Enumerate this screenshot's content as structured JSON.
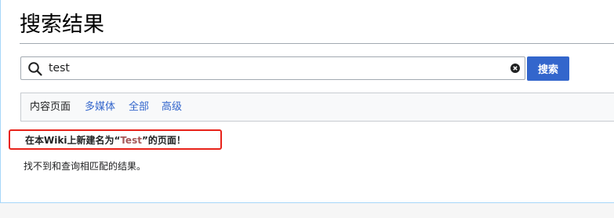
{
  "page": {
    "title": "搜索结果"
  },
  "search": {
    "value": "test",
    "button_label": "搜索"
  },
  "filters": [
    {
      "label": "内容页面",
      "current": true
    },
    {
      "label": "多媒体",
      "current": false
    },
    {
      "label": "全部",
      "current": false
    },
    {
      "label": "高级",
      "current": false
    }
  ],
  "create_notice": {
    "prefix": "在本Wiki上新建名为“",
    "link": "Test",
    "suffix": "”的页面！"
  },
  "results": {
    "message": "找不到和查询相匹配的结果。"
  },
  "colors": {
    "accent": "#3366cc",
    "highlight_box": "#e8231a",
    "new_link": "#a55858"
  },
  "icons": {
    "search": "search-icon",
    "clear": "clear-icon"
  }
}
